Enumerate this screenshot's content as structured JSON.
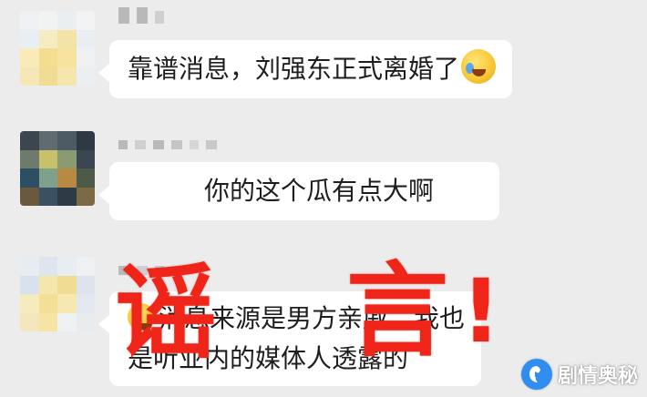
{
  "messages": [
    {
      "text": "靠谱消息，刘强东正式离婚了",
      "emoji": "crying-laughing-emoji"
    },
    {
      "text": "你的这个瓜有点大啊"
    },
    {
      "line1": "消息来源是男方亲戚，我也",
      "line2": "是听业内的媒体人透露的",
      "emoji": "crying-laughing-emoji"
    }
  ],
  "stamp": {
    "char1": "谣",
    "char2": "言",
    "char3": "!"
  },
  "watermark": {
    "text": "剧情奥秘"
  },
  "colors": {
    "background": "#ececec",
    "bubble": "#ffffff",
    "stamp": "#ee2518",
    "watermark_logo": "#2f8ef0"
  }
}
